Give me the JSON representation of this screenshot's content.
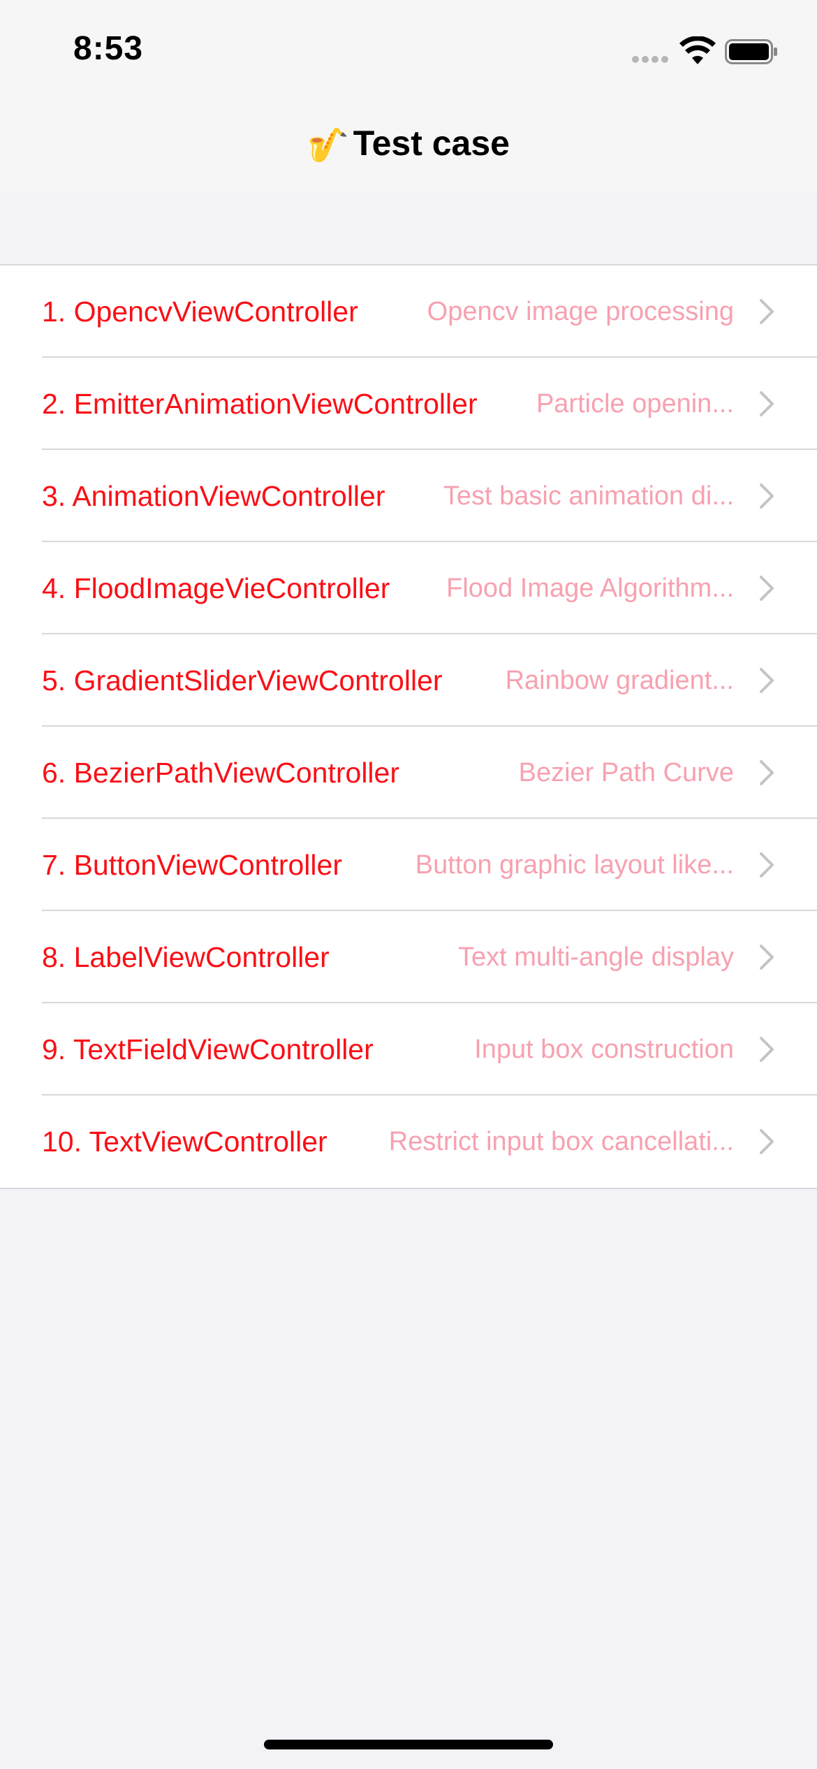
{
  "status_bar": {
    "time": "8:53",
    "icons": [
      "cellular-signal-icon",
      "wifi-icon",
      "battery-icon"
    ]
  },
  "nav": {
    "icon": "🎷",
    "title": "Test case"
  },
  "colors": {
    "title_red": "#fa0f16",
    "detail_pink": "#f7a1b0",
    "background": "#f2f2f7"
  },
  "rows": [
    {
      "title": "1. OpencvViewController",
      "detail": "Opencv image processing"
    },
    {
      "title": "2. EmitterAnimationViewController",
      "detail": "Particle openin..."
    },
    {
      "title": "3. AnimationViewController",
      "detail": "Test basic animation di..."
    },
    {
      "title": "4. FloodImageVieController",
      "detail": "Flood Image Algorithm..."
    },
    {
      "title": "5. GradientSliderViewController",
      "detail": "Rainbow gradient..."
    },
    {
      "title": "6. BezierPathViewController",
      "detail": "Bezier Path Curve"
    },
    {
      "title": "7. ButtonViewController",
      "detail": "Button graphic layout like..."
    },
    {
      "title": "8. LabelViewController",
      "detail": "Text multi-angle display"
    },
    {
      "title": "9. TextFieldViewController",
      "detail": "Input box construction"
    },
    {
      "title": "10. TextViewController",
      "detail": "Restrict input box cancellati..."
    }
  ]
}
